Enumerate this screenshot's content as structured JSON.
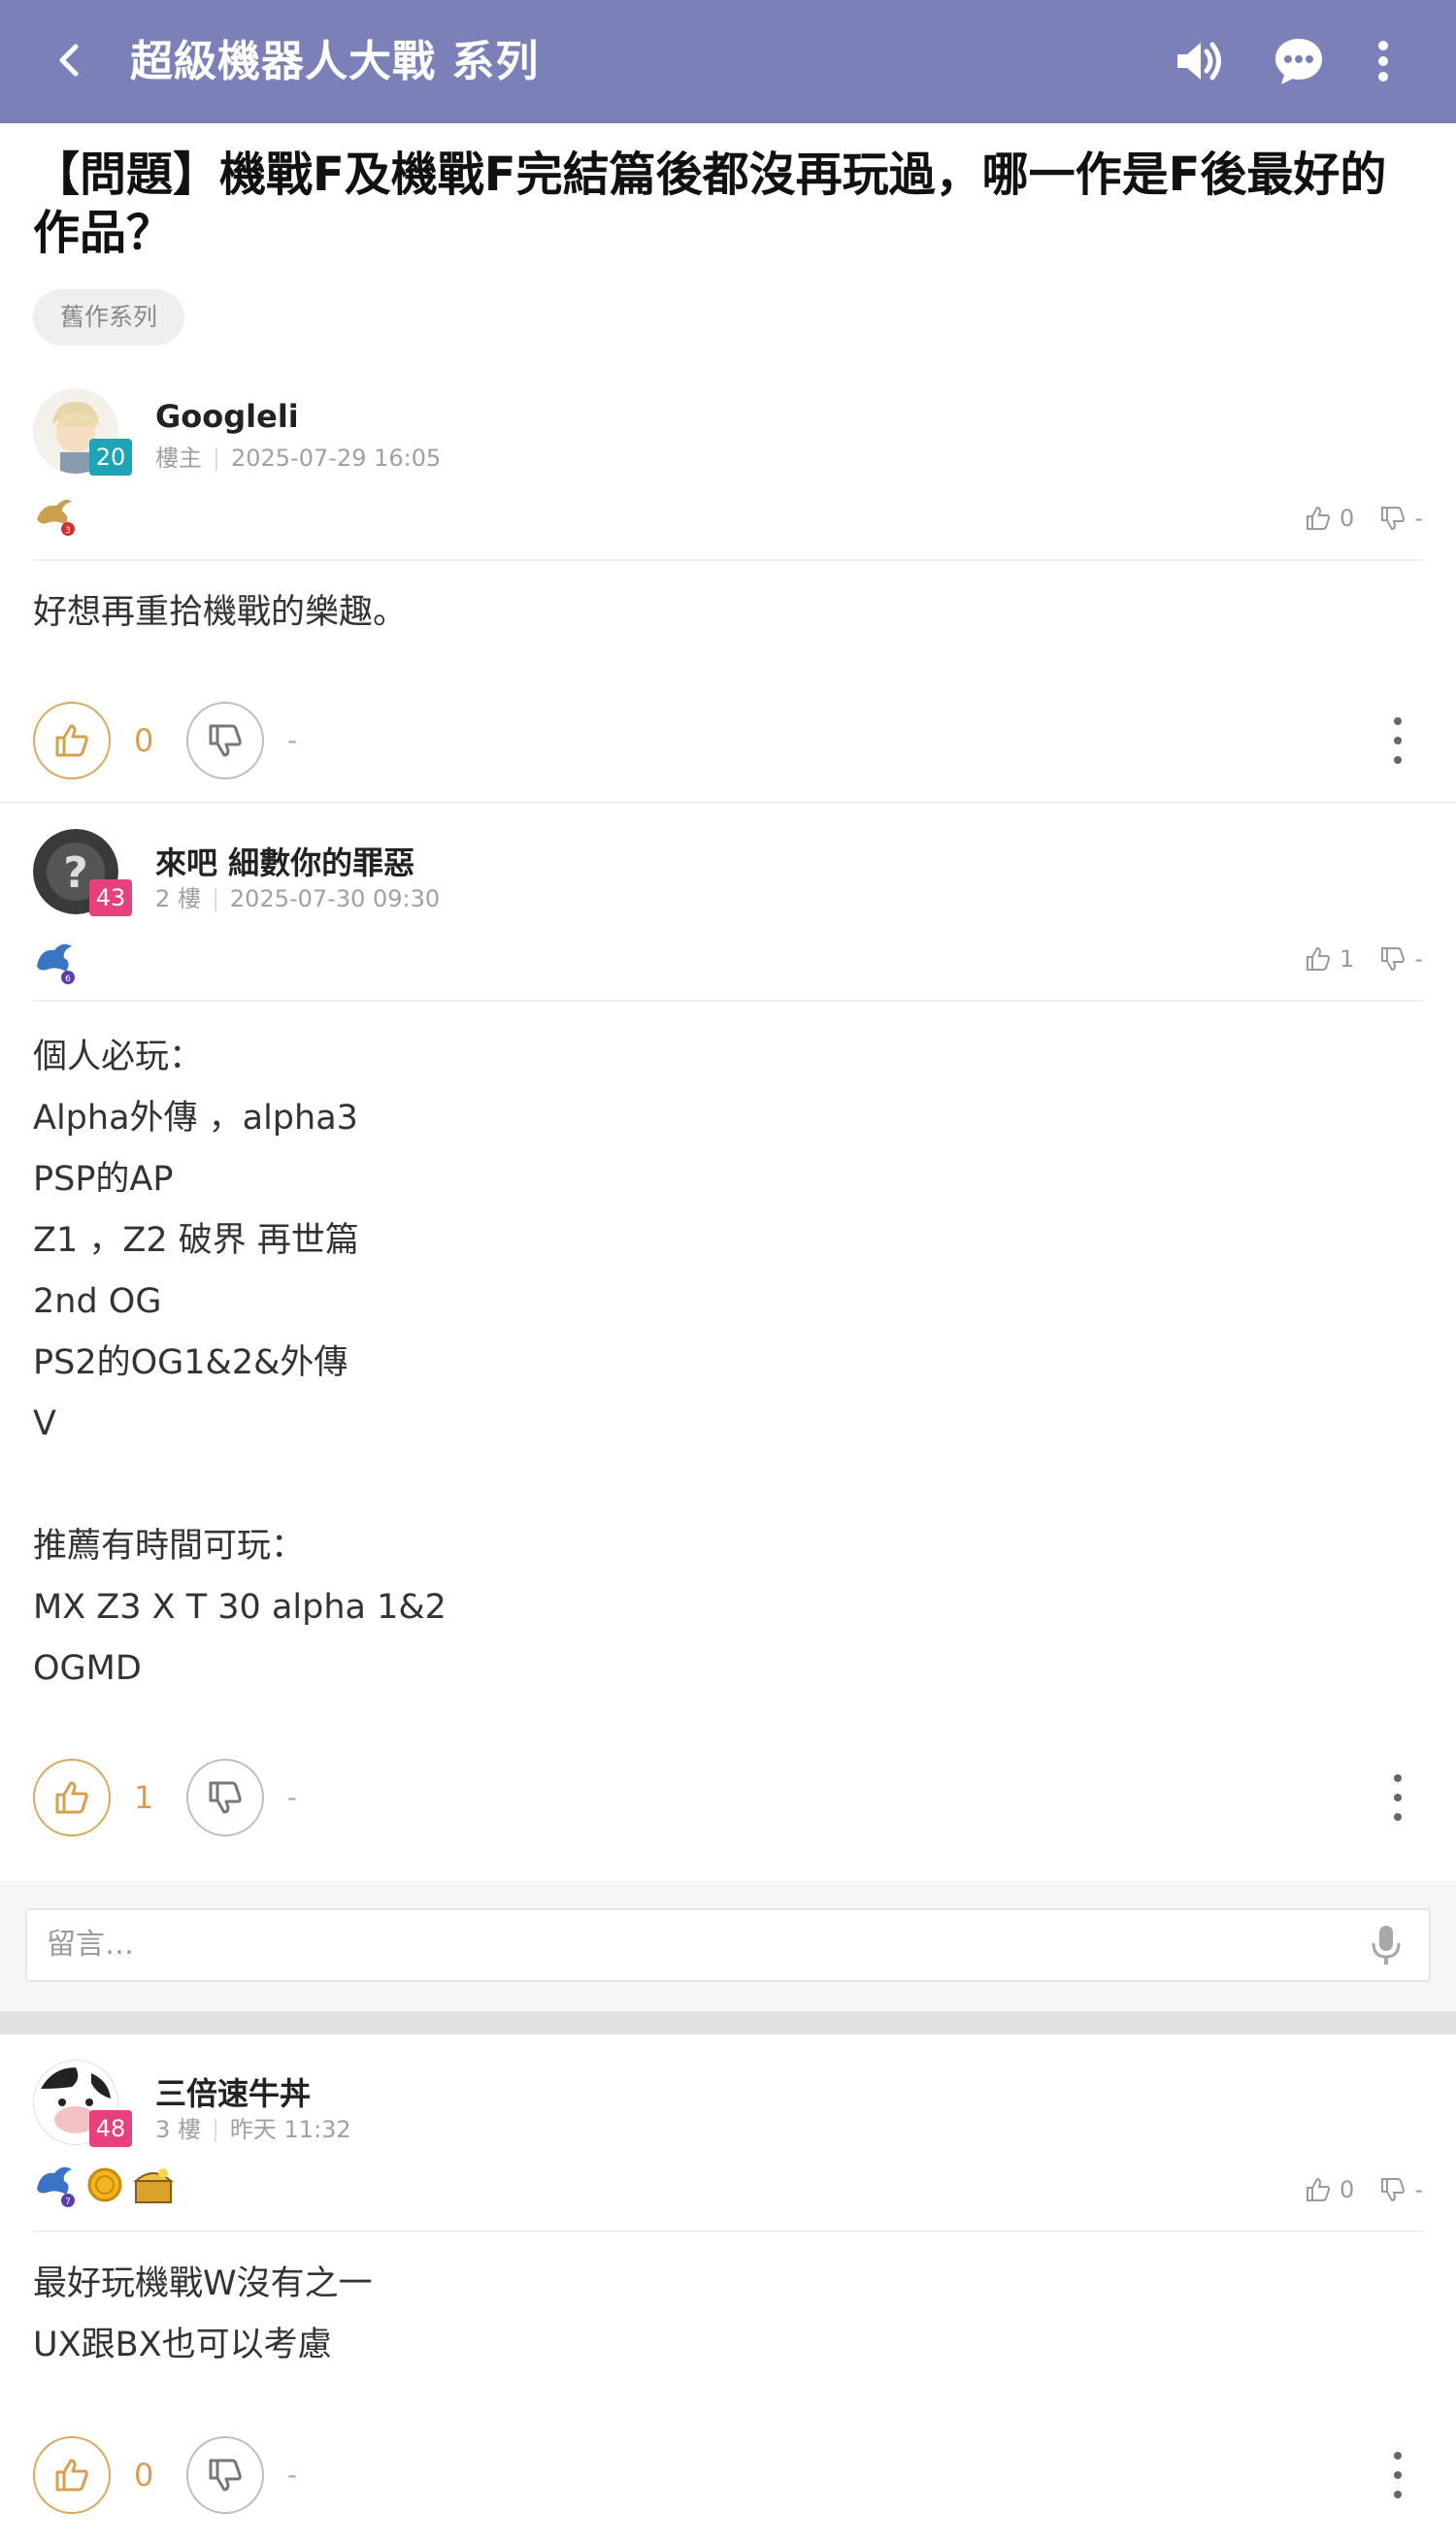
{
  "appbar": {
    "title": "超級機器人大戰 系列",
    "bg_color": "#7b81b8",
    "icons": [
      "back-arrow-icon",
      "speaker-icon",
      "chat-bubble-icon",
      "more-vert-icon"
    ]
  },
  "thread": {
    "title": "【問題】機戰F及機戰F完結篇後都沒再玩過，哪一作是F後最好的作品？",
    "tag": "舊作系列"
  },
  "posts": [
    {
      "username": "Googleli",
      "level": "20",
      "level_color": "#1fa4b5",
      "floor": "樓主",
      "time": "2025-07-29 16:05",
      "mini_up": "0",
      "mini_down": "-",
      "content": "好想再重拾機戰的樂趣。",
      "up_count": "0",
      "down_count": "-"
    },
    {
      "username": "來吧 細數你的罪惡",
      "level": "43",
      "level_color": "#e8407a",
      "floor": "2 樓",
      "time": "2025-07-30 09:30",
      "mini_up": "1",
      "mini_down": "-",
      "content": "個人必玩：\nAlpha外傳 ，alpha3\nPSP的AP\nZ1 ，Z2 破界 再世篇\n2nd OG\nPS2的OG1&2&外傳\nV\n\n推薦有時間可玩：\nMX Z3 X T 30 alpha 1&2\nOGMD",
      "up_count": "1",
      "down_count": "-"
    },
    {
      "username": "三倍速牛丼",
      "level": "48",
      "level_color": "#e8407a",
      "floor": "3 樓",
      "time": "昨天 11:32",
      "mini_up": "0",
      "mini_down": "-",
      "content": "最好玩機戰W沒有之一\nUX跟BX也可以考慮",
      "up_count": "0",
      "down_count": "-"
    }
  ],
  "comment": {
    "placeholder": "留言…"
  },
  "colors": {
    "like_accent": "#d4a24e",
    "divider": "#eeeeee"
  }
}
